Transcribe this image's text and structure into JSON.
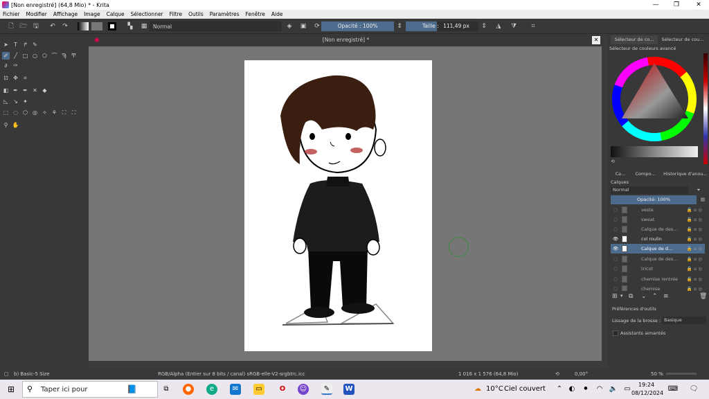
{
  "window": {
    "title": "[Non enregistré]  (64,8 Mio)  * - Krita",
    "minimize_icon": "minimize-icon",
    "maximize_icon": "maximize-icon",
    "close_icon": "close-icon"
  },
  "menu": [
    "Fichier",
    "Modifier",
    "Affichage",
    "Image",
    "Calque",
    "Sélectionner",
    "Filtre",
    "Outils",
    "Paramètres",
    "Fenêtre",
    "Aide"
  ],
  "toolbar": {
    "blend_mode": "Normal",
    "opacity": "Opacité : 100%",
    "size_label": "Taille :",
    "size_value": "111,49 px"
  },
  "canvas": {
    "document_tab": "[Non enregistré]  *"
  },
  "docker": {
    "tabs_top": [
      "Sélecteur de co...",
      "Sélecteur de cou..."
    ],
    "color_selector_title": "Sélecteur de couleurs avancé",
    "tabs_mid": [
      "Ca...",
      "Compo...",
      "Historique d'anou..."
    ],
    "layers_title": "Calques",
    "layers_blend": "Normal",
    "layers_opacity": "Opacité:  100%",
    "layers": [
      {
        "name": "veste",
        "visible": false,
        "active": false
      },
      {
        "name": "sweat",
        "visible": false,
        "active": false
      },
      {
        "name": "Calque de des...",
        "visible": false,
        "active": false
      },
      {
        "name": "col roulin",
        "visible": true,
        "active": false
      },
      {
        "name": "Calque de d...",
        "visible": true,
        "active": true
      },
      {
        "name": "Calque de des...",
        "visible": false,
        "active": false
      },
      {
        "name": "tricot",
        "visible": false,
        "active": false
      },
      {
        "name": "chemise rentrée",
        "visible": false,
        "active": false
      },
      {
        "name": "chemise",
        "visible": false,
        "active": false
      }
    ],
    "tool_options_title": "Préférences d'outils",
    "smoothing_label": "Lissage de la brosse :",
    "smoothing_value": "Basique",
    "magnetic_label": "Assistants aimantés"
  },
  "status": {
    "brush": "b) Basic-5 Size",
    "color_space": "RGB/Alpha (Entier sur 8 bits / canal)  sRGB-elle-V2-srgbtrc.icc",
    "dimensions": "1 016 x 1 576 (64,8 Mio)",
    "rotation": "0,00°",
    "zoom": "50 %"
  },
  "taskbar": {
    "search_placeholder": "Taper ici pour",
    "weather_temp": "10°C",
    "weather_text": "Ciel couvert",
    "time": "19:24",
    "date": "08/12/2024"
  },
  "colors": {
    "accent": "#4d6b8c",
    "canvas_bg": "#767676",
    "panel_bg": "#383838"
  }
}
